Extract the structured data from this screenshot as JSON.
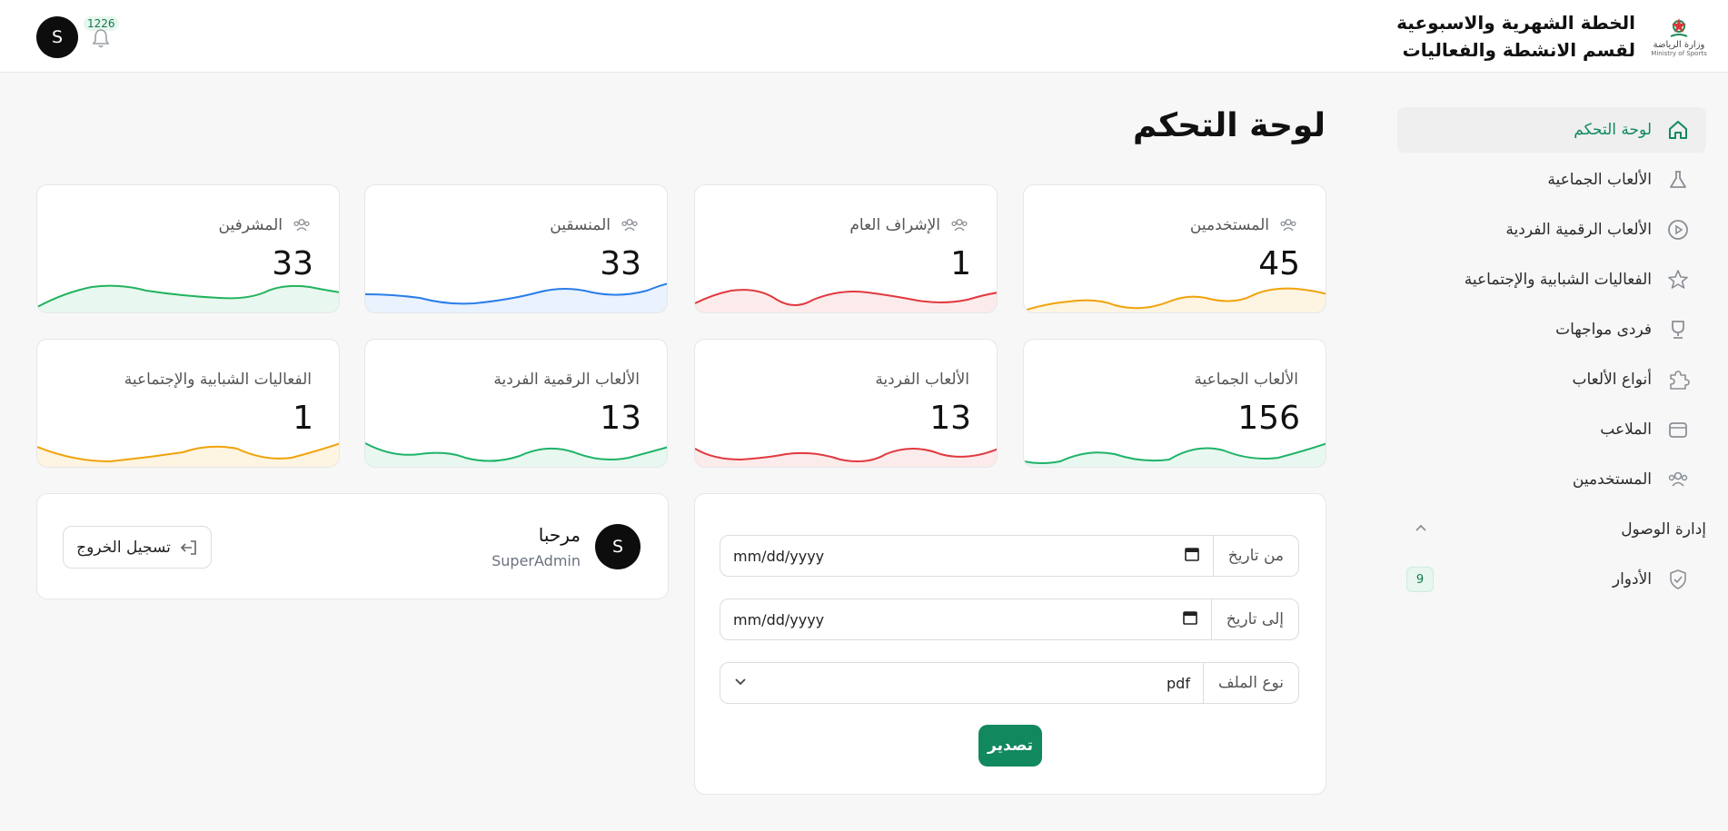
{
  "header": {
    "ministry_logo_text": "وزارة الرياضة",
    "ministry_logo_sub": "Ministry of Sports",
    "title_line1": "الخطة الشهرية والاسبوعية",
    "title_line2": "لقسم الانشطة والفعاليات",
    "notification_count": "1226",
    "user_initial": "S"
  },
  "sidebar": {
    "items": [
      {
        "label": "لوحة التحكم",
        "icon": "home-icon",
        "active": true
      },
      {
        "label": "الألعاب الجماعية",
        "icon": "flask-icon"
      },
      {
        "label": "الألعاب الرقمية الفردية",
        "icon": "play-circle-icon"
      },
      {
        "label": "الفعاليات الشبابية والإجتماعية",
        "icon": "star-icon"
      },
      {
        "label": "فردى مواجهات",
        "icon": "trophy-icon"
      },
      {
        "label": "أنواع الألعاب",
        "icon": "puzzle-icon"
      },
      {
        "label": "الملاعب",
        "icon": "archive-icon"
      },
      {
        "label": "المستخدمين",
        "icon": "users-icon"
      }
    ],
    "section": {
      "label": "إدارة الوصول",
      "icon": "chevron-up-icon"
    },
    "roles": {
      "label": "الأدوار",
      "icon": "shield-icon",
      "badge": "9"
    }
  },
  "page_title": "لوحة التحكم",
  "stats": {
    "row1": [
      {
        "label": "المستخدمين",
        "value": "45",
        "color": "#f0a30a"
      },
      {
        "label": "الإشراف العام",
        "value": "1",
        "color": "#e0393e"
      },
      {
        "label": "المنسقين",
        "value": "33",
        "color": "#2b7de9"
      },
      {
        "label": "المشرفين",
        "value": "33",
        "color": "#22b35e"
      }
    ],
    "row2": [
      {
        "label": "الألعاب الجماعية",
        "value": "156",
        "color": "#1fb36a"
      },
      {
        "label": "الألعاب الفردية",
        "value": "13",
        "color": "#e0393e"
      },
      {
        "label": "الألعاب الرقمية الفردية",
        "value": "13",
        "color": "#1fb36a"
      },
      {
        "label": "الفعاليات الشبابية والإجتماعية",
        "value": "1",
        "color": "#f0a30a"
      }
    ]
  },
  "export": {
    "from_label": "من تاريخ",
    "from_placeholder": "mm/dd/yyyy",
    "to_label": "إلى تاريخ",
    "to_placeholder": "mm/dd/yyyy",
    "type_label": "نوع الملف",
    "type_value": "pdf",
    "button_label": "تصدير"
  },
  "welcome": {
    "initial": "S",
    "greeting": "مرحبا",
    "role": "SuperAdmin",
    "logout_label": "تسجيل الخروج"
  }
}
